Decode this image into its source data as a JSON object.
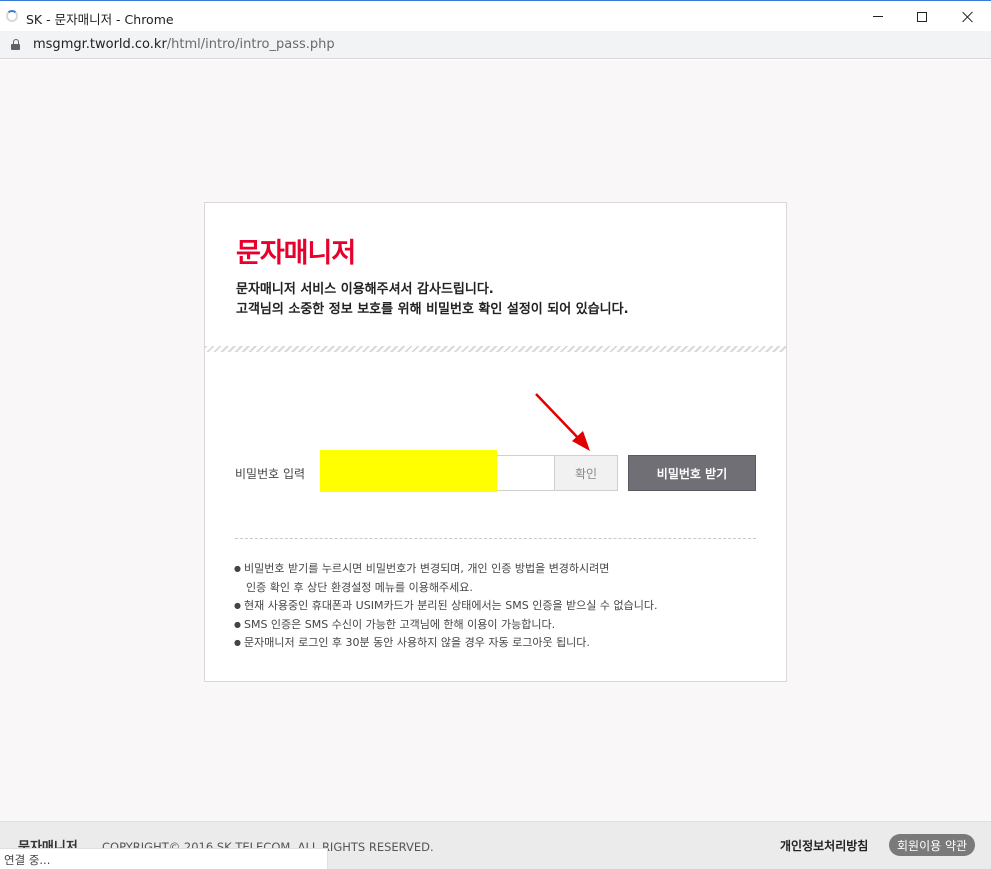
{
  "window": {
    "title": "SK - 문자매니저 - Chrome",
    "controls": {
      "minimize": "minimize",
      "maximize": "maximize",
      "close": "close"
    }
  },
  "address": {
    "domain": "msgmgr.tworld.co.kr",
    "path": "/html/intro/intro_pass.php"
  },
  "card": {
    "logo": "문자매니저",
    "intro_line1": "문자매니저 서비스 이용해주셔서 감사드립니다.",
    "intro_line2": "고객님의 소중한 정보 보호를 위해 비밀번호 확인 설정이 되어 있습니다.",
    "password_label": "비밀번호 입력",
    "password_value": "",
    "confirm_button": "확인",
    "get_password_button": "비밀번호 받기",
    "notes": [
      "비밀번호 받기를 누르시면 비밀번호가 변경되며, 개인 인증 방법을 변경하시려면",
      "인증 확인 후 상단 환경설정 메뉴를 이용해주세요.",
      "현재 사용중인 휴대폰과 USIM카드가 분리된 상태에서는 SMS 인증을 받으실 수 없습니다.",
      "SMS 인증은 SMS 수신이 가능한 고객님에 한해 이용이 가능합니다.",
      "문자매니저 로그인 후 30분 동안 사용하지 않을 경우 자동 로그아웃 됩니다."
    ]
  },
  "footer": {
    "logo": "문자매니저",
    "copyright": "COPYRIGHT© 2016 SK TELECOM. ALL RIGHTS RESERVED.",
    "privacy_link": "개인정보처리방침",
    "terms_link": "회원이용 약관"
  },
  "status_bar": "연결 중...",
  "colors": {
    "brand_red": "#e8002d",
    "highlight": "#ffff00",
    "annotation_arrow": "#e00000"
  },
  "icons": {
    "loading": "loading-spinner-icon",
    "lock": "lock-icon",
    "annotation": "red-arrow-icon"
  }
}
